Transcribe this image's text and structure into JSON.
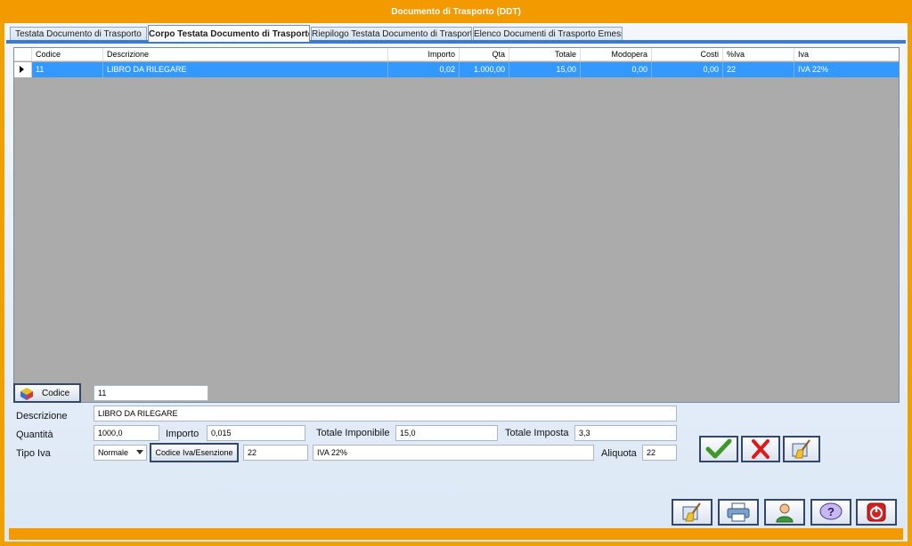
{
  "window": {
    "title": "Documento di Trasporto  (DDT)"
  },
  "tabs": [
    {
      "label": "Testata Documento di Trasporto"
    },
    {
      "label": "Corpo Testata Documento di Trasporto"
    },
    {
      "label": "Riepilogo Testata Documento di Trasporto"
    },
    {
      "label": "Elenco Documenti di Trasporto Emessi"
    }
  ],
  "grid": {
    "columns": [
      "Codice",
      "Descrizione",
      "Importo",
      "Qta",
      "Totale",
      "Modopera",
      "Costi",
      "%Iva",
      "Iva"
    ],
    "rows": [
      {
        "codice": "11",
        "descrizione": "LIBRO DA RILEGARE",
        "importo": "0,02",
        "qta": "1.000,00",
        "totale": "15,00",
        "modopera": "0,00",
        "costi": "0,00",
        "piva": "22",
        "iva": "IVA 22%"
      }
    ]
  },
  "form": {
    "codice_label": "Codice",
    "codice_value": "11",
    "descrizione_label": "Descrizione",
    "descrizione_value": "LIBRO DA RILEGARE",
    "quantita_label": "Quantità",
    "quantita_value": "1000,0",
    "importo_label": "Importo",
    "importo_value": "0,015",
    "totale_imponibile_label": "Totale Imponibile",
    "totale_imponibile_value": "15,0",
    "totale_imposta_label": "Totale Imposta",
    "totale_imposta_value": "3,3",
    "tipo_iva_label": "Tipo Iva",
    "tipo_iva_value": "Normale",
    "codice_iva_button": "Codice Iva/Esenzione",
    "codice_iva_value": "22",
    "iva_desc_value": "IVA 22%",
    "aliquota_label": "Aliquota",
    "aliquota_value": "22"
  },
  "colors": {
    "title_bar": "#f39a00",
    "selection": "#3399ff",
    "grid_bg": "#ababab"
  }
}
